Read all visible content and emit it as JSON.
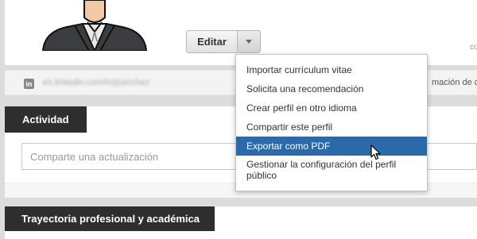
{
  "profile": {
    "edit_label": "Editar",
    "right_fragment": "cor"
  },
  "url_strip": {
    "icon_label": "in",
    "url_text": "es.linkedin.com/in/jsanchez",
    "right_text": "mación de co"
  },
  "activity": {
    "title": "Actividad",
    "input_placeholder": "Comparte una actualización"
  },
  "career": {
    "title": "Trayectoria profesional y académica"
  },
  "edit_menu": {
    "items": [
      "Importar currículum vitae",
      "Solicita una recomendación",
      "Crear perfil en otro idioma",
      "Compartir este perfil",
      "Exportar como PDF",
      "Gestionar la configuración del perfil público"
    ],
    "active_index": 4
  },
  "colors": {
    "accent": "#2a6aa9",
    "section_header": "#2e2e2e"
  },
  "icons": {
    "dropdown": "chevron-down-icon",
    "linkedin": "linkedin-icon",
    "cursor": "pointer-cursor-icon"
  }
}
